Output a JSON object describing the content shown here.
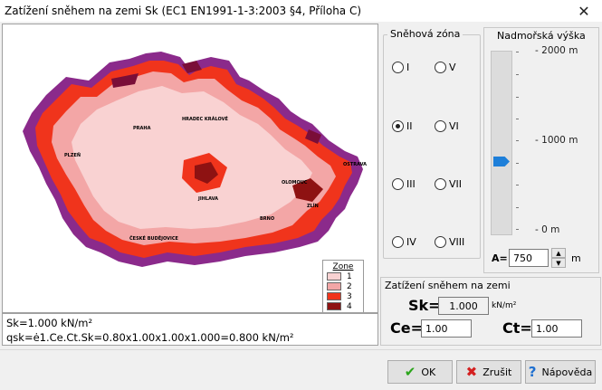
{
  "window": {
    "title": "Zatížení sněhem na zemi Sk (EC1 EN1991-1-3:2003 §4, Příloha C)",
    "close_glyph": "✕"
  },
  "map": {
    "cities": [
      "PLZEŇ",
      "PRAHA",
      "HRADEC KRÁLOVÉ",
      "BRNO",
      "OLOMOUC",
      "OSTRAVA",
      "ZLÍN",
      "JIHLAVA",
      "ČESKÉ BUDĚJOVICE"
    ],
    "legend": {
      "title": "Zone",
      "zones": [
        {
          "label": "1",
          "color": "#f9d2d2"
        },
        {
          "label": "2",
          "color": "#f3a6a6"
        },
        {
          "label": "3",
          "color": "#f0341c"
        },
        {
          "label": "4",
          "color": "#8e1212"
        }
      ]
    },
    "extra_colors": {
      "zone5": "#7a0e38",
      "zone6": "#8b2a8b"
    }
  },
  "formula": {
    "line1": "Sk=1.000 kN/m²",
    "line2": "qsk=ė1.Ce.Ct.Sk=0.80x1.00x1.00x1.000=0.800 kN/m²"
  },
  "snow_zone": {
    "title": "Sněhová zóna",
    "options": [
      "I",
      "II",
      "III",
      "IV",
      "V",
      "VI",
      "VII",
      "VIII"
    ],
    "selected": "II"
  },
  "altitude": {
    "title": "Nadmořská výška",
    "labels": [
      "2000 m",
      "1000 m",
      "0 m"
    ],
    "value_label": "A=",
    "value": "750",
    "unit": "m",
    "level_fraction": 0.375
  },
  "load": {
    "title": "Zatížení sněhem na zemi",
    "sk_label": "Sk",
    "sk_value": "1.000",
    "sk_unit": "kN/m²",
    "ce_label": "Ce",
    "ce_value": "1.00",
    "ct_label": "Ct",
    "ct_value": "1.00",
    "eq": "="
  },
  "buttons": {
    "ok": "OK",
    "cancel": "Zrušit",
    "help": "Nápověda"
  }
}
